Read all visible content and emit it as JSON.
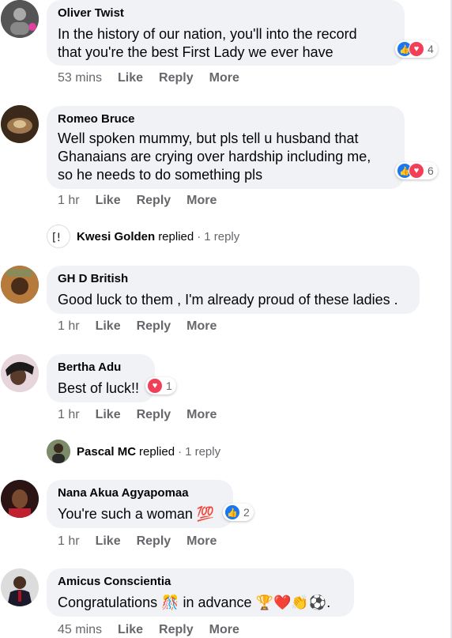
{
  "colors": {
    "bubble": "#f0f2f5",
    "muted": "#65676b",
    "like": "#1877f2",
    "love": "#f33e58"
  },
  "comments": [
    {
      "author": "Oliver Twist",
      "lines": [
        "In the history of our nation, you'll into the record",
        "that you're the best First Lady we ever have"
      ],
      "time": "53 mins",
      "like": "Like",
      "reply": "Reply",
      "more": "More",
      "reactions": "4",
      "reaction_icons": [
        "like-icon",
        "love-icon"
      ]
    },
    {
      "author": "Romeo Bruce",
      "lines": [
        "Well spoken mummy, but pls tell u husband that",
        "Ghanaians are crying over hardship including me,",
        "so he needs to do something pls"
      ],
      "time": "1 hr",
      "like": "Like",
      "reply": "Reply",
      "more": "More",
      "reactions": "6",
      "reaction_icons": [
        "like-icon",
        "love-icon"
      ]
    },
    {
      "author": "GH D British",
      "lines": [
        "Good luck to them , I'm already proud of these ladies ."
      ],
      "time": "1 hr",
      "like": "Like",
      "reply": "Reply",
      "more": "More"
    },
    {
      "author": "Bertha Adu",
      "lines": [
        "Best of luck!!"
      ],
      "time": "1 hr",
      "like": "Like",
      "reply": "Reply",
      "more": "More",
      "reactions": "1",
      "reaction_icons": [
        "love-icon"
      ]
    },
    {
      "author": "Nana Akua Agyapomaa",
      "lines": [
        "You're such a woman 💯"
      ],
      "time": "1 hr",
      "like": "Like",
      "reply": "Reply",
      "more": "More",
      "reactions": "2",
      "reaction_icons": [
        "like-icon"
      ]
    },
    {
      "author": "Amicus Conscientia",
      "lines": [
        "Congratulations 🎊 in advance 🏆❤️👏⚽."
      ],
      "time": "45 mins",
      "like": "Like",
      "reply": "Reply",
      "more": "More"
    }
  ],
  "replies": [
    {
      "author": "Kwesi Golden",
      "verb": "replied",
      "sep": "·",
      "count": "1 reply"
    },
    {
      "author": "Pascal MC",
      "verb": "replied",
      "sep": "·",
      "count": "1 reply"
    }
  ]
}
